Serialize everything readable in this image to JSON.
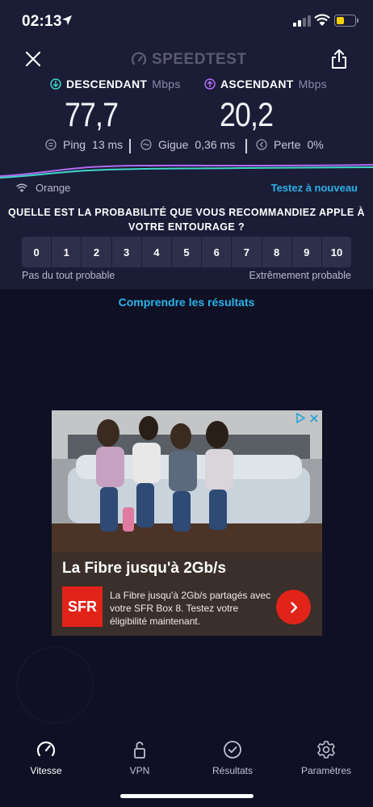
{
  "status_bar": {
    "time": "02:13"
  },
  "header": {
    "brand": "SPEEDTEST"
  },
  "download": {
    "label": "DESCENDANT",
    "unit": "Mbps",
    "value": "77,7",
    "color": "#3fd6c9"
  },
  "upload": {
    "label": "ASCENDANT",
    "unit": "Mbps",
    "value": "20,2",
    "color": "#b06cf2"
  },
  "stats": {
    "ping": {
      "label": "Ping",
      "value": "13 ms"
    },
    "jitter": {
      "label": "Gigue",
      "value": "0,36 ms"
    },
    "loss": {
      "label": "Perte",
      "value": "0%"
    }
  },
  "network": {
    "isp": "Orange"
  },
  "retest_label": "Testez à nouveau",
  "survey": {
    "question_line1": "QUELLE EST LA PROBABILITÉ QUE VOUS RECOMMANDIEZ APPLE À",
    "question_line2": "VOTRE ENTOURAGE ?",
    "options": [
      "0",
      "1",
      "2",
      "3",
      "4",
      "5",
      "6",
      "7",
      "8",
      "9",
      "10"
    ],
    "low_label": "Pas du tout probable",
    "high_label": "Extrêmement probable"
  },
  "understand_link": "Comprendre les résultats",
  "ad": {
    "title": "La Fibre jusqu'à 2Gb/s",
    "logo_text": "SFR",
    "description": "La Fibre jusqu'à 2Gb/s partagés avec votre SFR Box 8. Testez votre éligibilité maintenant.",
    "brand_color": "#e2231a"
  },
  "tabs": [
    {
      "label": "Vitesse",
      "icon": "speedometer-icon",
      "active": true
    },
    {
      "label": "VPN",
      "icon": "lock-icon",
      "active": false
    },
    {
      "label": "Résultats",
      "icon": "check-circle-icon",
      "active": false
    },
    {
      "label": "Paramètres",
      "icon": "gear-icon",
      "active": false
    }
  ],
  "colors": {
    "accent": "#2ab3e6",
    "background": "#0f1024",
    "panel": "#1b1c36"
  }
}
